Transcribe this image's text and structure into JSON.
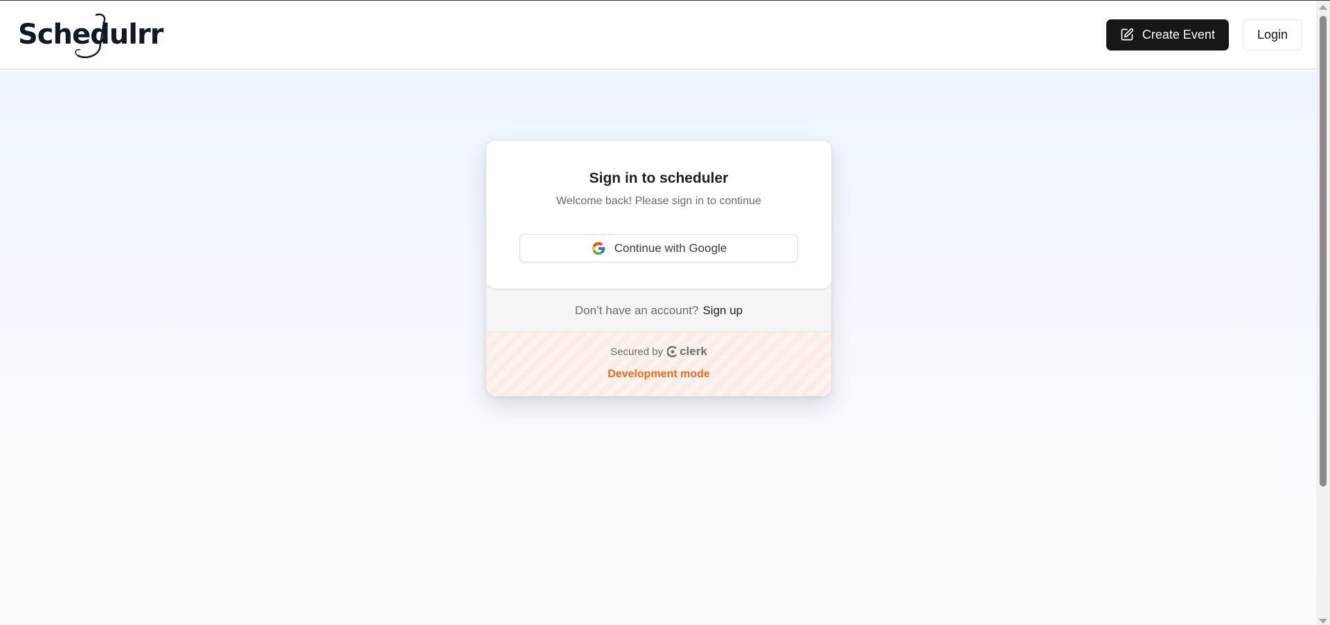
{
  "header": {
    "logo_text": "Schedulrr",
    "create_event_label": "Create Event",
    "login_label": "Login"
  },
  "sign_in": {
    "title": "Sign in to scheduler",
    "subtitle": "Welcome back! Please sign in to continue",
    "google_label": "Continue with Google",
    "no_account_text": "Don’t have an account?",
    "signup_label": "Sign up",
    "secured_by": "Secured by",
    "provider": "clerk",
    "dev_mode": "Development mode"
  },
  "colors": {
    "primary_button": "#171717",
    "dev_mode_accent": "#f36b16",
    "background_gradient_top": "#eef4fe"
  },
  "icons": [
    "edit-icon",
    "google-icon",
    "clerk-logo-icon"
  ]
}
